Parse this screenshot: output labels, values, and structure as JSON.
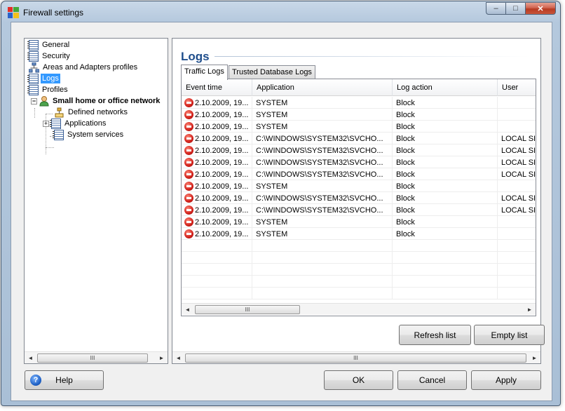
{
  "window": {
    "title": "Firewall settings",
    "minimize_glyph": "–",
    "maximize_glyph": "□",
    "close_glyph": "✕"
  },
  "tree": {
    "items": [
      {
        "label": "General",
        "icon": "document-icon"
      },
      {
        "label": "Security",
        "icon": "document-icon"
      },
      {
        "label": "Areas and Adapters profiles",
        "icon": "network-icon"
      },
      {
        "label": "Logs",
        "icon": "document-icon",
        "selected": true
      },
      {
        "label": "Profiles",
        "icon": "document-icon"
      },
      {
        "label": "Small home or office network",
        "icon": "user-icon",
        "bold": true
      },
      {
        "label": "Defined networks",
        "icon": "network-icon"
      },
      {
        "label": "Applications",
        "icon": "document-icon"
      },
      {
        "label": "System services",
        "icon": "document-icon"
      }
    ],
    "expander_minus": "−",
    "expander_plus": "+"
  },
  "scroll": {
    "left_arrow": "◄",
    "right_arrow": "►",
    "thumb_grip": "III"
  },
  "main": {
    "title": "Logs",
    "tabs": [
      "Traffic Logs",
      "Trusted Database Logs"
    ],
    "active_tab": "Traffic Logs",
    "columns": [
      "Event time",
      "Application",
      "Log action",
      "User"
    ],
    "rows": [
      {
        "time": "2.10.2009, 19...",
        "app": "SYSTEM",
        "action": "Block",
        "user": ""
      },
      {
        "time": "2.10.2009, 19...",
        "app": "SYSTEM",
        "action": "Block",
        "user": ""
      },
      {
        "time": "2.10.2009, 19...",
        "app": "SYSTEM",
        "action": "Block",
        "user": ""
      },
      {
        "time": "2.10.2009, 19...",
        "app": "C:\\WINDOWS\\SYSTEM32\\SVCHO...",
        "action": "Block",
        "user": "LOCAL SI"
      },
      {
        "time": "2.10.2009, 19...",
        "app": "C:\\WINDOWS\\SYSTEM32\\SVCHO...",
        "action": "Block",
        "user": "LOCAL SI"
      },
      {
        "time": "2.10.2009, 19...",
        "app": "C:\\WINDOWS\\SYSTEM32\\SVCHO...",
        "action": "Block",
        "user": "LOCAL SI"
      },
      {
        "time": "2.10.2009, 19...",
        "app": "C:\\WINDOWS\\SYSTEM32\\SVCHO...",
        "action": "Block",
        "user": "LOCAL SI"
      },
      {
        "time": "2.10.2009, 19...",
        "app": "SYSTEM",
        "action": "Block",
        "user": ""
      },
      {
        "time": "2.10.2009, 19...",
        "app": "C:\\WINDOWS\\SYSTEM32\\SVCHO...",
        "action": "Block",
        "user": "LOCAL SI"
      },
      {
        "time": "2.10.2009, 19...",
        "app": "C:\\WINDOWS\\SYSTEM32\\SVCHO...",
        "action": "Block",
        "user": "LOCAL SI"
      },
      {
        "time": "2.10.2009, 19...",
        "app": "SYSTEM",
        "action": "Block",
        "user": ""
      },
      {
        "time": "2.10.2009, 19...",
        "app": "SYSTEM",
        "action": "Block",
        "user": ""
      }
    ],
    "refresh_label": "Refresh list",
    "empty_label": "Empty list"
  },
  "footer": {
    "help_label": "Help",
    "help_glyph": "?",
    "ok_label": "OK",
    "cancel_label": "Cancel",
    "apply_label": "Apply"
  },
  "colors": {
    "accent_title": "#1f4e8c",
    "selection": "#3399ff",
    "block_icon": "#d0201a"
  }
}
